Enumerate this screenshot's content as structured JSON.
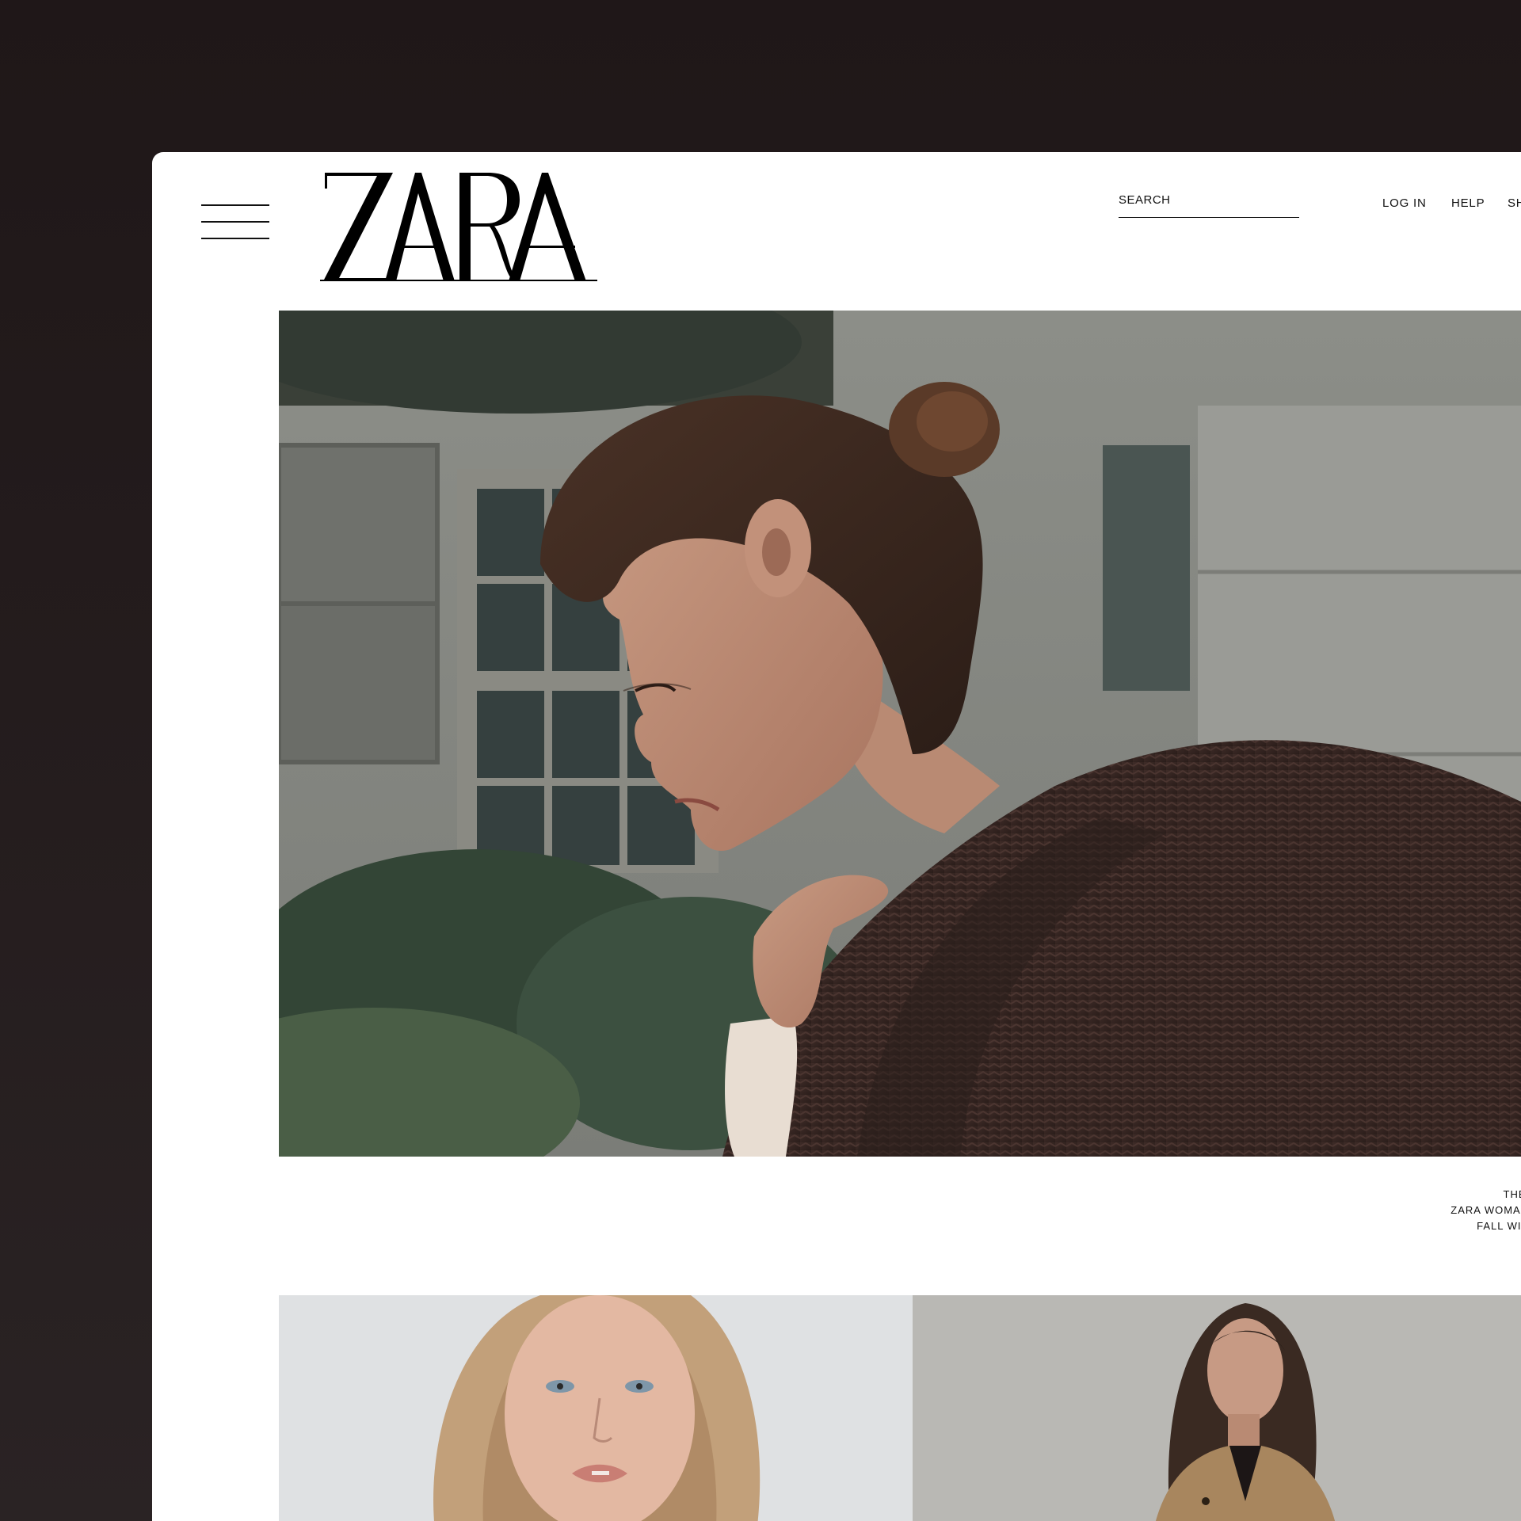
{
  "header": {
    "menu_icon": "hamburger-menu-icon",
    "logo_text": "ZARA",
    "search": {
      "placeholder": "SEARCH",
      "value": ""
    },
    "nav": {
      "login": "LOG IN",
      "help": "HELP",
      "shop": "SH"
    }
  },
  "hero": {
    "caption": [
      "THE",
      "ZARA WOMAN COLLEC",
      "FALL WINTER"
    ]
  },
  "colors": {
    "background": "#221a1b",
    "page": "#ffffff",
    "text": "#111111",
    "sweater": "#3b2925"
  }
}
